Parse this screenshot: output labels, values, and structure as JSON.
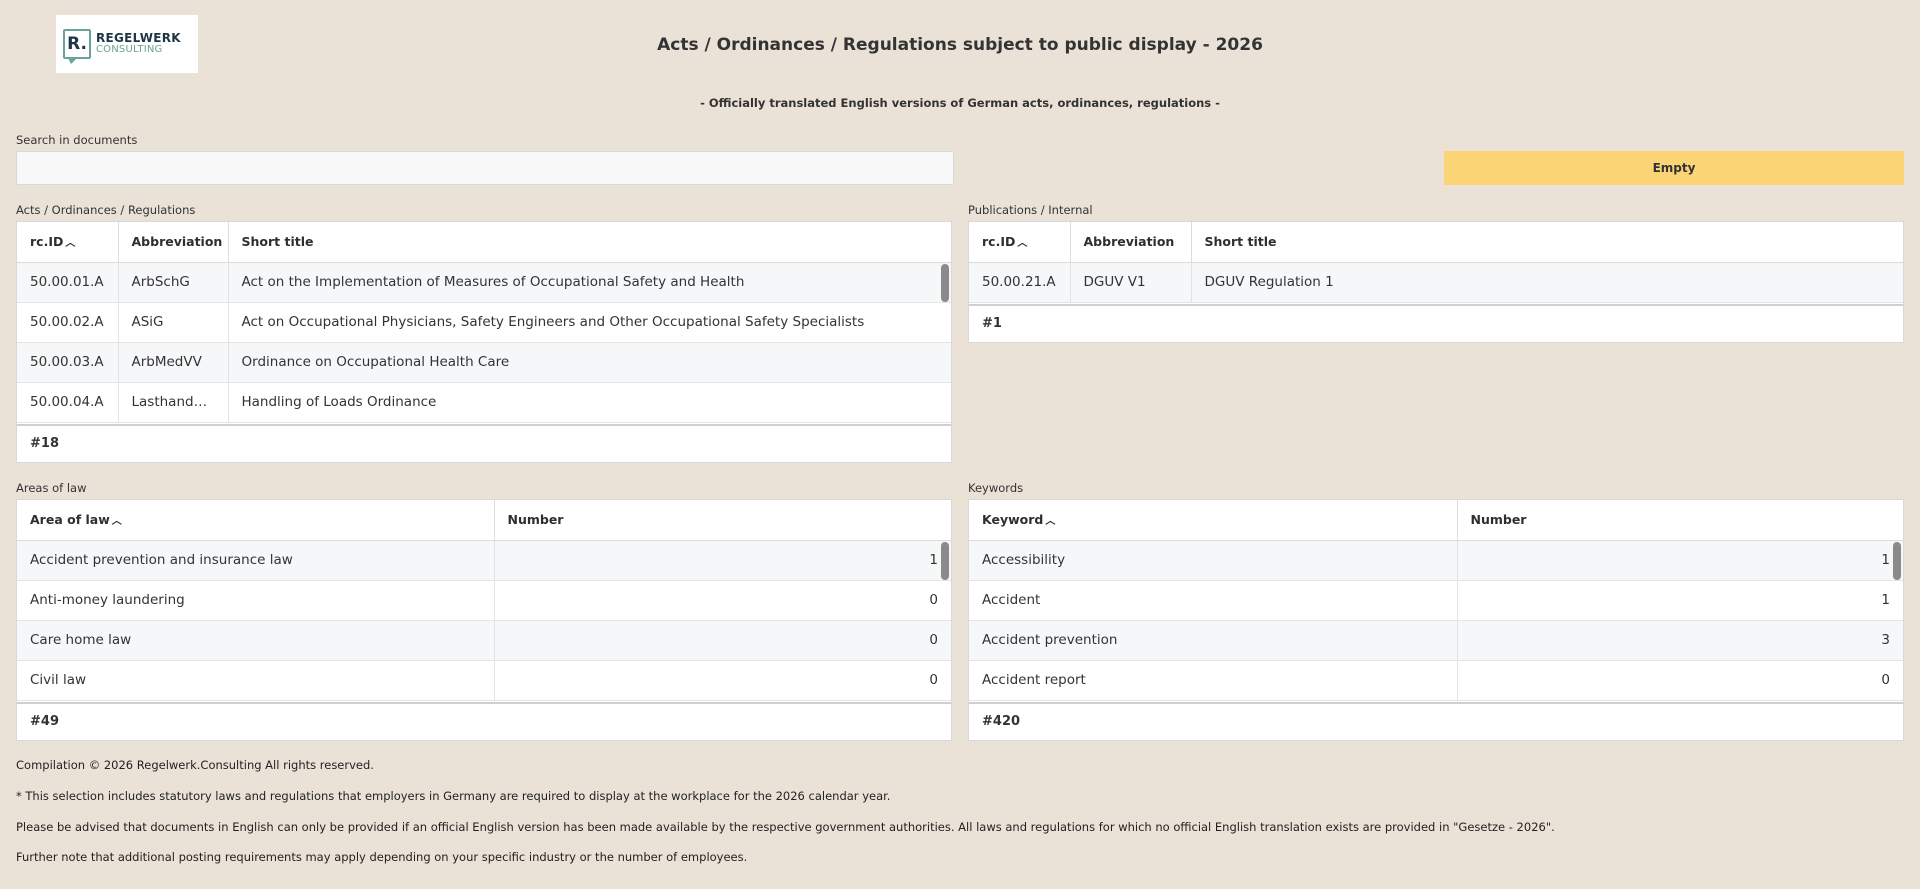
{
  "logo": {
    "mark": "R.",
    "line1": "REGELWERK",
    "line2": "CONSULTING"
  },
  "header": {
    "title": "Acts / Ordinances / Regulations subject to public display - 2026",
    "subtitle": "- Officially translated English versions of German acts, ordinances, regulations -"
  },
  "search": {
    "label": "Search in documents",
    "value": "",
    "placeholder": ""
  },
  "empty_button": "Empty",
  "acts": {
    "label": "Acts / Ordinances / Regulations",
    "headers": [
      "rc.ID",
      "Abbreviation",
      "Short title"
    ],
    "rows": [
      [
        "50.00.01.A",
        "ArbSchG",
        "Act on the Implementation of Measures of Occupational Safety and Health"
      ],
      [
        "50.00.02.A",
        "ASiG",
        "Act on Occupational Physicians, Safety Engineers and Other Occupational Safety Specialists"
      ],
      [
        "50.00.03.A",
        "ArbMedVV",
        "Ordinance on Occupational Health Care"
      ],
      [
        "50.00.04.A",
        "LasthandhabV",
        "Handling of Loads Ordinance"
      ]
    ],
    "count": "#18"
  },
  "publications": {
    "label": "Publications / Internal",
    "headers": [
      "rc.ID",
      "Abbreviation",
      "Short title"
    ],
    "rows": [
      [
        "50.00.21.A",
        "DGUV V1",
        "DGUV Regulation 1"
      ]
    ],
    "count": "#1"
  },
  "areas": {
    "label": "Areas of law",
    "headers": [
      "Area of law",
      "Number"
    ],
    "rows": [
      [
        "Accident prevention and insurance law",
        "1"
      ],
      [
        "Anti-money laundering",
        "0"
      ],
      [
        "Care home law",
        "0"
      ],
      [
        "Civil law",
        "0"
      ]
    ],
    "count": "#49"
  },
  "keywords": {
    "label": "Keywords",
    "headers": [
      "Keyword",
      "Number"
    ],
    "rows": [
      [
        "Accessibility",
        "1"
      ],
      [
        "Accident",
        "1"
      ],
      [
        "Accident prevention",
        "3"
      ],
      [
        "Accident report",
        "0"
      ]
    ],
    "count": "#420"
  },
  "footer": {
    "line1": "Compilation © 2026 Regelwerk.Consulting  All rights reserved.",
    "line2": "* This selection includes statutory laws and regulations that employers in Germany are required to display at the workplace for the 2026 calendar year.",
    "line3": "Please be advised that documents in English can only be provided if an official English version has been made available by the respective government authorities. All laws and regulations for which no official English translation exists are provided in \"Gesetze - 2026\".",
    "line4": "Further note that additional posting requirements may apply depending on your specific industry or the number of employees."
  },
  "sort_icon": "chevron-up-icon"
}
